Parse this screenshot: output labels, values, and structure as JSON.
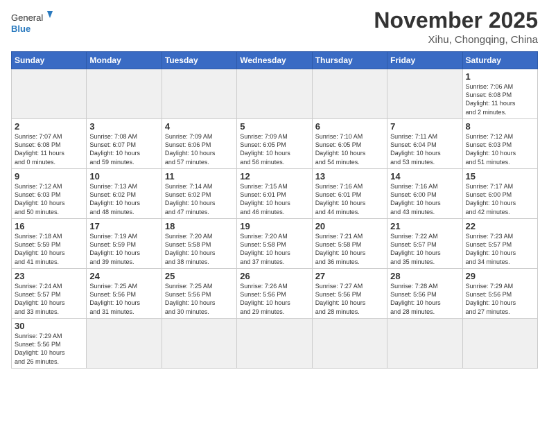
{
  "logo": {
    "text_general": "General",
    "text_blue": "Blue"
  },
  "header": {
    "title": "November 2025",
    "subtitle": "Xihu, Chongqing, China"
  },
  "weekdays": [
    "Sunday",
    "Monday",
    "Tuesday",
    "Wednesday",
    "Thursday",
    "Friday",
    "Saturday"
  ],
  "weeks": [
    [
      {
        "day": "",
        "info": "",
        "empty": true
      },
      {
        "day": "",
        "info": "",
        "empty": true
      },
      {
        "day": "",
        "info": "",
        "empty": true
      },
      {
        "day": "",
        "info": "",
        "empty": true
      },
      {
        "day": "",
        "info": "",
        "empty": true
      },
      {
        "day": "",
        "info": "",
        "empty": true
      },
      {
        "day": "1",
        "info": "Sunrise: 7:06 AM\nSunset: 6:08 PM\nDaylight: 11 hours\nand 2 minutes."
      }
    ],
    [
      {
        "day": "2",
        "info": "Sunrise: 7:07 AM\nSunset: 6:08 PM\nDaylight: 11 hours\nand 0 minutes."
      },
      {
        "day": "3",
        "info": "Sunrise: 7:08 AM\nSunset: 6:07 PM\nDaylight: 10 hours\nand 59 minutes."
      },
      {
        "day": "4",
        "info": "Sunrise: 7:09 AM\nSunset: 6:06 PM\nDaylight: 10 hours\nand 57 minutes."
      },
      {
        "day": "5",
        "info": "Sunrise: 7:09 AM\nSunset: 6:05 PM\nDaylight: 10 hours\nand 56 minutes."
      },
      {
        "day": "6",
        "info": "Sunrise: 7:10 AM\nSunset: 6:05 PM\nDaylight: 10 hours\nand 54 minutes."
      },
      {
        "day": "7",
        "info": "Sunrise: 7:11 AM\nSunset: 6:04 PM\nDaylight: 10 hours\nand 53 minutes."
      },
      {
        "day": "8",
        "info": "Sunrise: 7:12 AM\nSunset: 6:03 PM\nDaylight: 10 hours\nand 51 minutes."
      }
    ],
    [
      {
        "day": "9",
        "info": "Sunrise: 7:12 AM\nSunset: 6:03 PM\nDaylight: 10 hours\nand 50 minutes."
      },
      {
        "day": "10",
        "info": "Sunrise: 7:13 AM\nSunset: 6:02 PM\nDaylight: 10 hours\nand 48 minutes."
      },
      {
        "day": "11",
        "info": "Sunrise: 7:14 AM\nSunset: 6:02 PM\nDaylight: 10 hours\nand 47 minutes."
      },
      {
        "day": "12",
        "info": "Sunrise: 7:15 AM\nSunset: 6:01 PM\nDaylight: 10 hours\nand 46 minutes."
      },
      {
        "day": "13",
        "info": "Sunrise: 7:16 AM\nSunset: 6:01 PM\nDaylight: 10 hours\nand 44 minutes."
      },
      {
        "day": "14",
        "info": "Sunrise: 7:16 AM\nSunset: 6:00 PM\nDaylight: 10 hours\nand 43 minutes."
      },
      {
        "day": "15",
        "info": "Sunrise: 7:17 AM\nSunset: 6:00 PM\nDaylight: 10 hours\nand 42 minutes."
      }
    ],
    [
      {
        "day": "16",
        "info": "Sunrise: 7:18 AM\nSunset: 5:59 PM\nDaylight: 10 hours\nand 41 minutes."
      },
      {
        "day": "17",
        "info": "Sunrise: 7:19 AM\nSunset: 5:59 PM\nDaylight: 10 hours\nand 39 minutes."
      },
      {
        "day": "18",
        "info": "Sunrise: 7:20 AM\nSunset: 5:58 PM\nDaylight: 10 hours\nand 38 minutes."
      },
      {
        "day": "19",
        "info": "Sunrise: 7:20 AM\nSunset: 5:58 PM\nDaylight: 10 hours\nand 37 minutes."
      },
      {
        "day": "20",
        "info": "Sunrise: 7:21 AM\nSunset: 5:58 PM\nDaylight: 10 hours\nand 36 minutes."
      },
      {
        "day": "21",
        "info": "Sunrise: 7:22 AM\nSunset: 5:57 PM\nDaylight: 10 hours\nand 35 minutes."
      },
      {
        "day": "22",
        "info": "Sunrise: 7:23 AM\nSunset: 5:57 PM\nDaylight: 10 hours\nand 34 minutes."
      }
    ],
    [
      {
        "day": "23",
        "info": "Sunrise: 7:24 AM\nSunset: 5:57 PM\nDaylight: 10 hours\nand 33 minutes."
      },
      {
        "day": "24",
        "info": "Sunrise: 7:25 AM\nSunset: 5:56 PM\nDaylight: 10 hours\nand 31 minutes."
      },
      {
        "day": "25",
        "info": "Sunrise: 7:25 AM\nSunset: 5:56 PM\nDaylight: 10 hours\nand 30 minutes."
      },
      {
        "day": "26",
        "info": "Sunrise: 7:26 AM\nSunset: 5:56 PM\nDaylight: 10 hours\nand 29 minutes."
      },
      {
        "day": "27",
        "info": "Sunrise: 7:27 AM\nSunset: 5:56 PM\nDaylight: 10 hours\nand 28 minutes."
      },
      {
        "day": "28",
        "info": "Sunrise: 7:28 AM\nSunset: 5:56 PM\nDaylight: 10 hours\nand 28 minutes."
      },
      {
        "day": "29",
        "info": "Sunrise: 7:29 AM\nSunset: 5:56 PM\nDaylight: 10 hours\nand 27 minutes."
      }
    ],
    [
      {
        "day": "30",
        "info": "Sunrise: 7:29 AM\nSunset: 5:56 PM\nDaylight: 10 hours\nand 26 minutes."
      },
      {
        "day": "",
        "info": "",
        "empty": true
      },
      {
        "day": "",
        "info": "",
        "empty": true
      },
      {
        "day": "",
        "info": "",
        "empty": true
      },
      {
        "day": "",
        "info": "",
        "empty": true
      },
      {
        "day": "",
        "info": "",
        "empty": true
      },
      {
        "day": "",
        "info": "",
        "empty": true
      }
    ]
  ]
}
